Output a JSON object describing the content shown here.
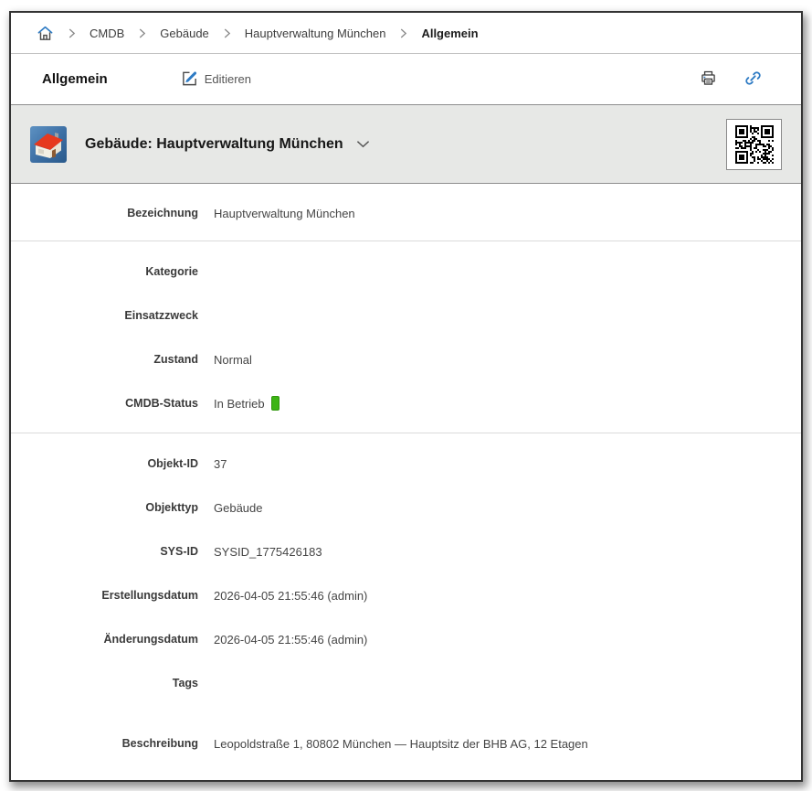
{
  "colors": {
    "accent_blue": "#2e7bc4",
    "status_green": "#3db414",
    "header_band_bg": "#e7e8e6"
  },
  "breadcrumb": {
    "items": [
      "CMDB",
      "Gebäude",
      "Hauptverwaltung München",
      "Allgemein"
    ]
  },
  "toolbar": {
    "title": "Allgemein",
    "edit_label": "Editieren"
  },
  "header": {
    "icon": "building-icon",
    "title": "Gebäude: Hauptverwaltung München"
  },
  "fields": {
    "bezeichnung": {
      "label": "Bezeichnung",
      "value": "Hauptverwaltung München"
    },
    "kategorie": {
      "label": "Kategorie",
      "value": ""
    },
    "einsatzzweck": {
      "label": "Einsatzzweck",
      "value": ""
    },
    "zustand": {
      "label": "Zustand",
      "value": "Normal"
    },
    "cmdb_status": {
      "label": "CMDB-Status",
      "value": "In Betrieb"
    },
    "objekt_id": {
      "label": "Objekt-ID",
      "value": "37"
    },
    "objekttyp": {
      "label": "Objekttyp",
      "value": "Gebäude"
    },
    "sys_id": {
      "label": "SYS-ID",
      "value": "SYSID_1775426183"
    },
    "erstellungsdatum": {
      "label": "Erstellungsdatum",
      "value": "2026-04-05 21:55:46 (admin)"
    },
    "aenderungsdatum": {
      "label": "Änderungsdatum",
      "value": "2026-04-05 21:55:46 (admin)"
    },
    "tags": {
      "label": "Tags",
      "value": ""
    },
    "beschreibung": {
      "label": "Beschreibung",
      "value": "Leopoldstraße 1, 80802 München — Hauptsitz der BHB AG, 12 Etagen"
    }
  }
}
